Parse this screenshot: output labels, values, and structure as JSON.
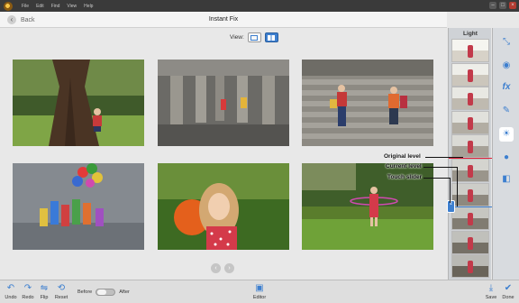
{
  "menubar": {
    "items": [
      "File",
      "Edit",
      "Find",
      "View",
      "Help"
    ]
  },
  "titlebar": {
    "back_label": "Back",
    "title": "Instant Fix"
  },
  "view": {
    "label": "View:"
  },
  "photos": [
    {
      "name": "tree-boy"
    },
    {
      "name": "colonnade-kids"
    },
    {
      "name": "family-steps"
    },
    {
      "name": "balloon-kids"
    },
    {
      "name": "girl-orange-ball"
    },
    {
      "name": "girl-hula-hoop"
    }
  ],
  "panel": {
    "label": "Light"
  },
  "callouts": {
    "original_level": "Original level",
    "current_level": "Current level",
    "touch_slider": "Touch slider"
  },
  "bottom": {
    "undo": "Undo",
    "redo": "Redo",
    "flip": "Flip",
    "reset": "Reset",
    "before": "Before",
    "after": "After",
    "editor": "Editor",
    "save": "Save",
    "done": "Done"
  },
  "colors": {
    "accent": "#3d7fcf",
    "original_marker": "#e0203a",
    "current_marker": "#3d7fcf"
  },
  "icons": [
    "crop-icon",
    "red-eye-icon",
    "fx-icon",
    "wrench-icon",
    "light-icon",
    "color-icon",
    "contrast-icon"
  ]
}
